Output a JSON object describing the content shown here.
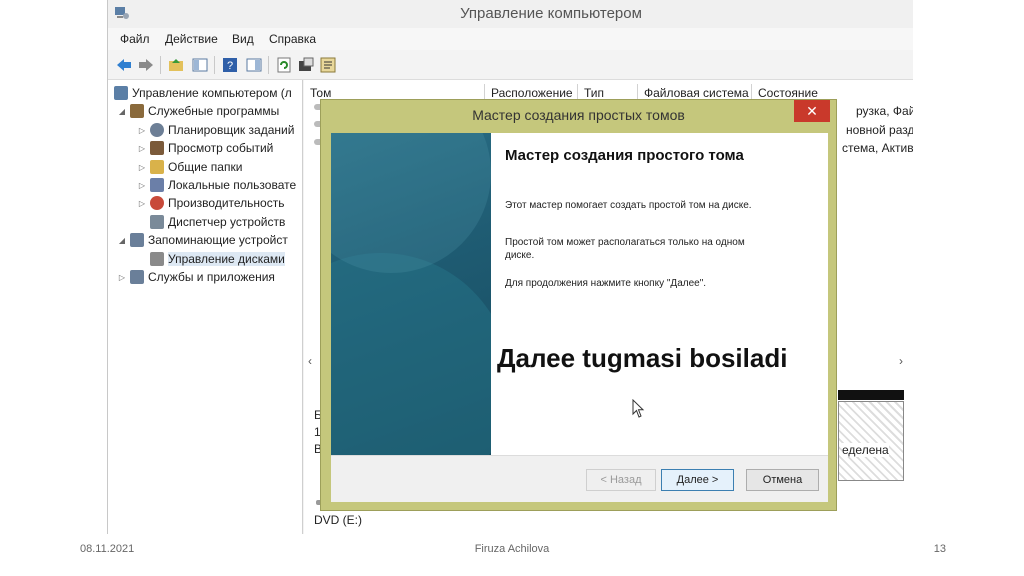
{
  "window": {
    "title": "Управление компьютером"
  },
  "menu": [
    "Файл",
    "Действие",
    "Вид",
    "Справка"
  ],
  "tree": [
    {
      "label": "Управление компьютером (л",
      "indent": 0,
      "twisty": "",
      "icon": "computer-icon",
      "color": "#5b7fa6"
    },
    {
      "label": "Служебные программы",
      "indent": 1,
      "twisty": "◢",
      "icon": "tools-icon",
      "color": "#8a6a3c"
    },
    {
      "label": "Планировщик заданий",
      "indent": 2,
      "twisty": "▷",
      "icon": "clock-icon",
      "color": "#6d7f96"
    },
    {
      "label": "Просмотр событий",
      "indent": 2,
      "twisty": "▷",
      "icon": "event-viewer-icon",
      "color": "#7b5a3a"
    },
    {
      "label": "Общие папки",
      "indent": 2,
      "twisty": "▷",
      "icon": "shared-folder-icon",
      "color": "#d9b24a"
    },
    {
      "label": "Локальные пользовате",
      "indent": 2,
      "twisty": "▷",
      "icon": "users-icon",
      "color": "#6b7fa8"
    },
    {
      "label": "Производительность",
      "indent": 2,
      "twisty": "▷",
      "icon": "performance-icon",
      "color": "#c84a3a"
    },
    {
      "label": "Диспетчер устройств",
      "indent": 2,
      "twisty": "",
      "icon": "device-manager-icon",
      "color": "#7a8a99"
    },
    {
      "label": "Запоминающие устройст",
      "indent": 1,
      "twisty": "◢",
      "icon": "storage-icon",
      "color": "#6a7f99"
    },
    {
      "label": "Управление дисками",
      "indent": 2,
      "twisty": "",
      "icon": "disk-icon",
      "color": "#8a8a8a",
      "selected": true
    },
    {
      "label": "Службы и приложения",
      "indent": 1,
      "twisty": "▷",
      "icon": "services-icon",
      "color": "#6a7f99"
    }
  ],
  "list": {
    "columns": [
      "Том",
      "Расположение",
      "Тип",
      "Файловая система",
      "Состояние"
    ],
    "right_fragments": [
      "рузка, Файл",
      "новной разд",
      "стема, Активн"
    ],
    "left_fragments": [
      "Б",
      "1",
      "В"
    ],
    "stripe_text": "еделена",
    "dvd": "DVD (E:)"
  },
  "dialog": {
    "title": "Мастер создания простых томов",
    "close": "✕",
    "heading": "Мастер создания простого тома",
    "p1": "Этот мастер помогает создать простой том на диске.",
    "p2": "Простой том может располагаться только на одном диске.",
    "p3": "Для продолжения нажмите кнопку \"Далее\".",
    "back": "< Назад",
    "next": "Далее >",
    "cancel": "Отмена"
  },
  "overlay": "Далее tugmasi bosiladi",
  "footer": {
    "date": "08.11.2021",
    "author": "Firuza Achilova",
    "page": "13"
  }
}
